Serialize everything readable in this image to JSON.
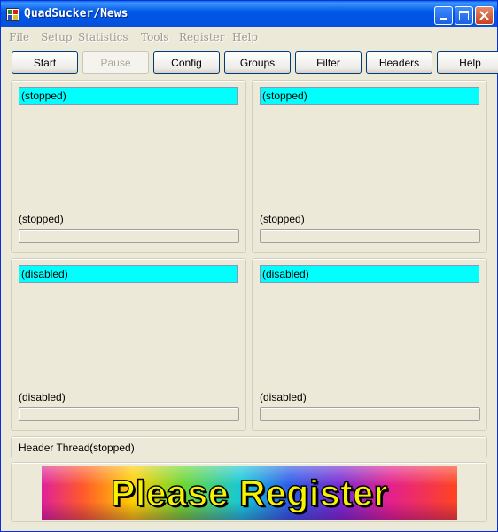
{
  "window": {
    "title": "QuadSucker/News",
    "controls": {
      "minimize": "minimize-icon",
      "maximize": "maximize-icon",
      "close": "close-icon"
    }
  },
  "menu": [
    "File",
    "Setup",
    "Statistics",
    "Tools",
    "Register",
    "Help"
  ],
  "toolbar": {
    "start": "Start",
    "pause": "Pause",
    "config": "Config",
    "groups": "Groups",
    "filter": "Filter",
    "headers": "Headers",
    "help": "Help"
  },
  "panels": [
    {
      "status": "(stopped)",
      "label": "(stopped)"
    },
    {
      "status": "(stopped)",
      "label": "(stopped)"
    },
    {
      "status": "(disabled)",
      "label": "(disabled)"
    },
    {
      "status": "(disabled)",
      "label": "(disabled)"
    }
  ],
  "header_thread": {
    "label": "Header Thread:",
    "value": "(stopped)"
  },
  "banner": {
    "text": "Please Register"
  },
  "colors": {
    "status_box": "#00FFFF",
    "window_bg": "#ECE9D8",
    "titlebar": "#0054E3",
    "banner_text": "#F6F200"
  }
}
